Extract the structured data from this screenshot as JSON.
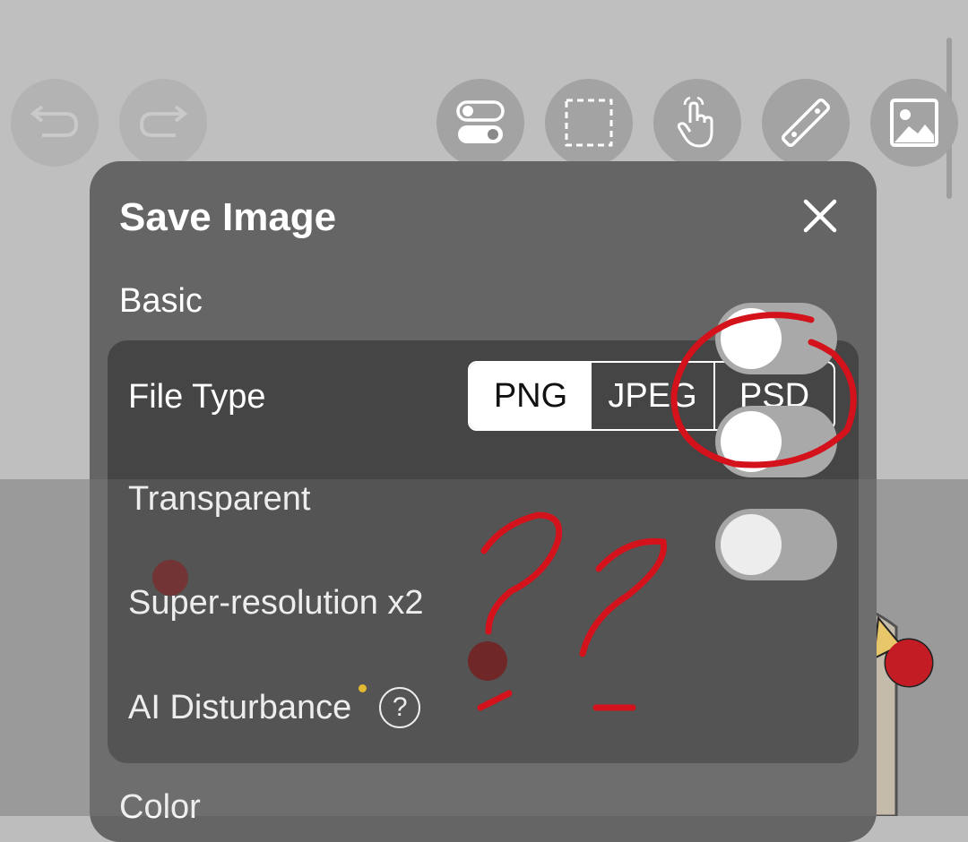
{
  "toolbar": {
    "undo_icon": "undo-icon",
    "redo_icon": "redo-icon",
    "toggle_icon": "toggle-switches-icon",
    "selection_icon": "selection-rect-icon",
    "touch_icon": "touch-hand-icon",
    "ruler_icon": "ruler-icon",
    "image_icon": "image-icon"
  },
  "dialog": {
    "title": "Save Image",
    "close_icon": "close-icon",
    "section_basic": "Basic",
    "section_color": "Color",
    "file_type": {
      "label": "File Type",
      "options": [
        "PNG",
        "JPEG",
        "PSD"
      ],
      "selected": "PNG"
    },
    "transparent": {
      "label": "Transparent",
      "on": false
    },
    "super_resolution": {
      "label": "Super-resolution x2",
      "on": false
    },
    "ai_disturbance": {
      "label": "AI Disturbance",
      "on": false,
      "help": "?"
    }
  },
  "colors": {
    "dialog_bg": "#656565",
    "card_bg": "#454545",
    "toggle_off": "#a9a9a9",
    "new_dot": "#f2c01b",
    "annotation_red": "#d3121c"
  }
}
